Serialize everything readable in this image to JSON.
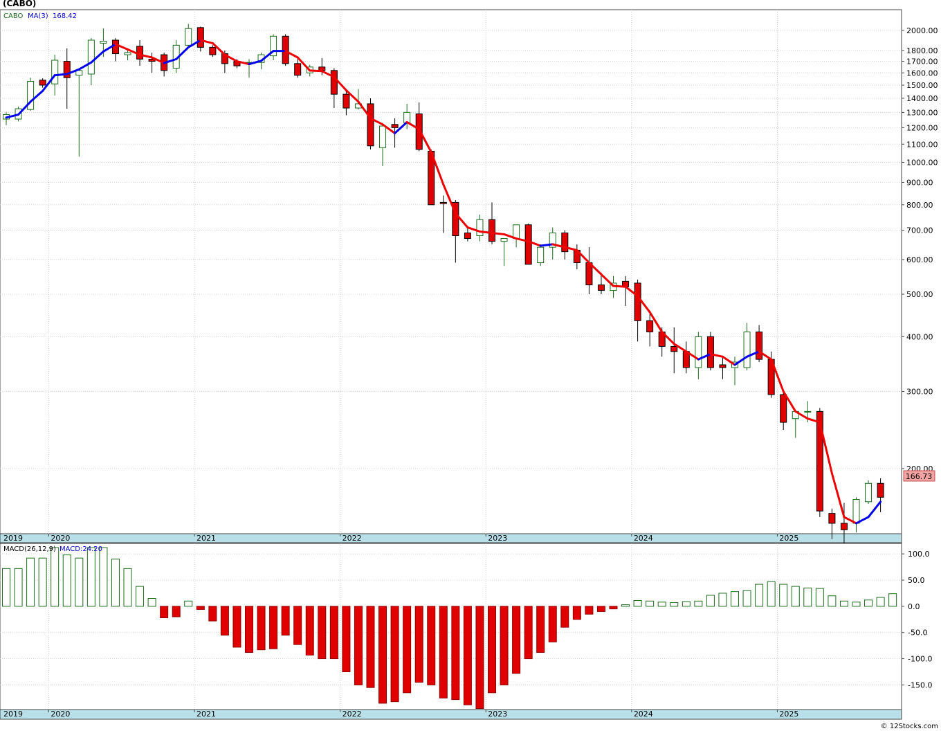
{
  "title": "(CABO)",
  "watermark": "© 12Stocks.com",
  "colors": {
    "up_candle_stroke": "#1a6b1a",
    "down_candle_fill": "#e00000",
    "ma_up": "#0000ee",
    "ma_down": "#ee0000",
    "axis_band": "#b9dfe8",
    "grid": "#d0d0d0",
    "last_price_label_bg": "#f4a3a3",
    "legend_symbol": "#1a6b1a",
    "legend_value": "#0000cc"
  },
  "chart_data": [
    {
      "type": "candlestick",
      "panel": "price",
      "legend": {
        "symbol": "CABO",
        "ma_label": "MA(3)",
        "ma_value": "168.42"
      },
      "last_price_label": "166.73",
      "y_scale": "log",
      "ylim": [
        142,
        2230
      ],
      "y_ticks": [
        200,
        300,
        400,
        500,
        600,
        700,
        800,
        900,
        1000,
        1100,
        1200,
        1300,
        1400,
        1500,
        1600,
        1700,
        1800,
        2000
      ],
      "y_tick_labels": [
        "200.00",
        "300.00",
        "400.00",
        "500.00",
        "600.00",
        "700.00",
        "800.00",
        "900.00",
        "1000.00",
        "1100.00",
        "1200.00",
        "1300.00",
        "1400.00",
        "1500.00",
        "1600.00",
        "1700.00",
        "1800.00",
        "2000.00"
      ],
      "x_labels": [
        "2019",
        "2020",
        "2021",
        "2022",
        "2023",
        "2024",
        "2025"
      ],
      "x_label_months": [
        0,
        4,
        16,
        28,
        40,
        52,
        64
      ],
      "months_total": 75,
      "candles": [
        {
          "o": 1255,
          "h": 1300,
          "l": 1215,
          "c": 1285
        },
        {
          "o": 1255,
          "h": 1340,
          "l": 1240,
          "c": 1325
        },
        {
          "o": 1320,
          "h": 1560,
          "l": 1310,
          "c": 1530
        },
        {
          "o": 1540,
          "h": 1555,
          "l": 1480,
          "c": 1500
        },
        {
          "o": 1510,
          "h": 1760,
          "l": 1420,
          "c": 1710
        },
        {
          "o": 1700,
          "h": 1820,
          "l": 1325,
          "c": 1560
        },
        {
          "o": 1580,
          "h": 1640,
          "l": 1030,
          "c": 1620
        },
        {
          "o": 1590,
          "h": 1920,
          "l": 1500,
          "c": 1900
        },
        {
          "o": 1870,
          "h": 2020,
          "l": 1740,
          "c": 1890
        },
        {
          "o": 1900,
          "h": 1920,
          "l": 1700,
          "c": 1770
        },
        {
          "o": 1760,
          "h": 1820,
          "l": 1710,
          "c": 1780
        },
        {
          "o": 1840,
          "h": 1900,
          "l": 1660,
          "c": 1720
        },
        {
          "o": 1720,
          "h": 1780,
          "l": 1600,
          "c": 1700
        },
        {
          "o": 1760,
          "h": 1780,
          "l": 1570,
          "c": 1620
        },
        {
          "o": 1640,
          "h": 1900,
          "l": 1600,
          "c": 1850
        },
        {
          "o": 1850,
          "h": 2070,
          "l": 1830,
          "c": 2020
        },
        {
          "o": 2030,
          "h": 2040,
          "l": 1790,
          "c": 1830
        },
        {
          "o": 1830,
          "h": 1850,
          "l": 1740,
          "c": 1760
        },
        {
          "o": 1770,
          "h": 1800,
          "l": 1600,
          "c": 1680
        },
        {
          "o": 1700,
          "h": 1720,
          "l": 1640,
          "c": 1660
        },
        {
          "o": 1690,
          "h": 1720,
          "l": 1560,
          "c": 1690
        },
        {
          "o": 1690,
          "h": 1780,
          "l": 1630,
          "c": 1760
        },
        {
          "o": 1750,
          "h": 1960,
          "l": 1710,
          "c": 1940
        },
        {
          "o": 1940,
          "h": 1960,
          "l": 1660,
          "c": 1680
        },
        {
          "o": 1680,
          "h": 1720,
          "l": 1560,
          "c": 1580
        },
        {
          "o": 1600,
          "h": 1670,
          "l": 1570,
          "c": 1650
        },
        {
          "o": 1650,
          "h": 1730,
          "l": 1580,
          "c": 1620
        },
        {
          "o": 1620,
          "h": 1640,
          "l": 1330,
          "c": 1430
        },
        {
          "o": 1430,
          "h": 1470,
          "l": 1280,
          "c": 1330
        },
        {
          "o": 1330,
          "h": 1470,
          "l": 1320,
          "c": 1360
        },
        {
          "o": 1360,
          "h": 1400,
          "l": 1070,
          "c": 1090
        },
        {
          "o": 1080,
          "h": 1230,
          "l": 980,
          "c": 1210
        },
        {
          "o": 1220,
          "h": 1260,
          "l": 1080,
          "c": 1200
        },
        {
          "o": 1230,
          "h": 1360,
          "l": 1190,
          "c": 1300
        },
        {
          "o": 1290,
          "h": 1370,
          "l": 1060,
          "c": 1070
        },
        {
          "o": 1060,
          "h": 1070,
          "l": 800,
          "c": 800
        },
        {
          "o": 810,
          "h": 840,
          "l": 690,
          "c": 805
        },
        {
          "o": 810,
          "h": 820,
          "l": 590,
          "c": 680
        },
        {
          "o": 690,
          "h": 710,
          "l": 660,
          "c": 670
        },
        {
          "o": 680,
          "h": 760,
          "l": 660,
          "c": 740
        },
        {
          "o": 740,
          "h": 810,
          "l": 650,
          "c": 660
        },
        {
          "o": 660,
          "h": 670,
          "l": 580,
          "c": 670
        },
        {
          "o": 670,
          "h": 720,
          "l": 640,
          "c": 720
        },
        {
          "o": 720,
          "h": 725,
          "l": 585,
          "c": 585
        },
        {
          "o": 590,
          "h": 650,
          "l": 580,
          "c": 640
        },
        {
          "o": 640,
          "h": 710,
          "l": 600,
          "c": 690
        },
        {
          "o": 690,
          "h": 700,
          "l": 600,
          "c": 625
        },
        {
          "o": 630,
          "h": 650,
          "l": 570,
          "c": 590
        },
        {
          "o": 590,
          "h": 640,
          "l": 500,
          "c": 525
        },
        {
          "o": 525,
          "h": 560,
          "l": 500,
          "c": 510
        },
        {
          "o": 510,
          "h": 550,
          "l": 490,
          "c": 530
        },
        {
          "o": 535,
          "h": 550,
          "l": 470,
          "c": 520
        },
        {
          "o": 530,
          "h": 540,
          "l": 390,
          "c": 435
        },
        {
          "o": 435,
          "h": 450,
          "l": 380,
          "c": 410
        },
        {
          "o": 410,
          "h": 420,
          "l": 360,
          "c": 380
        },
        {
          "o": 380,
          "h": 420,
          "l": 330,
          "c": 370
        },
        {
          "o": 370,
          "h": 390,
          "l": 330,
          "c": 340
        },
        {
          "o": 340,
          "h": 410,
          "l": 320,
          "c": 400
        },
        {
          "o": 400,
          "h": 410,
          "l": 335,
          "c": 340
        },
        {
          "o": 345,
          "h": 360,
          "l": 320,
          "c": 340
        },
        {
          "o": 340,
          "h": 360,
          "l": 310,
          "c": 350
        },
        {
          "o": 340,
          "h": 430,
          "l": 335,
          "c": 410
        },
        {
          "o": 410,
          "h": 425,
          "l": 350,
          "c": 355
        },
        {
          "o": 355,
          "h": 370,
          "l": 290,
          "c": 295
        },
        {
          "o": 295,
          "h": 300,
          "l": 245,
          "c": 255
        },
        {
          "o": 260,
          "h": 270,
          "l": 235,
          "c": 270
        },
        {
          "o": 270,
          "h": 285,
          "l": 255,
          "c": 270
        },
        {
          "o": 270,
          "h": 275,
          "l": 155,
          "c": 160
        },
        {
          "o": 158,
          "h": 162,
          "l": 138,
          "c": 150
        },
        {
          "o": 150,
          "h": 167,
          "l": 135,
          "c": 145
        },
        {
          "o": 150,
          "h": 172,
          "l": 143,
          "c": 170
        },
        {
          "o": 168,
          "h": 188,
          "l": 166,
          "c": 185
        },
        {
          "o": 185,
          "h": 190,
          "l": 159,
          "c": 172
        }
      ],
      "ma": [
        1265,
        1285,
        1375,
        1455,
        1580,
        1590,
        1630,
        1690,
        1790,
        1860,
        1810,
        1760,
        1735,
        1685,
        1720,
        1830,
        1900,
        1870,
        1760,
        1700,
        1675,
        1705,
        1795,
        1795,
        1735,
        1620,
        1615,
        1565,
        1460,
        1375,
        1260,
        1220,
        1165,
        1235,
        1190,
        1055,
        890,
        765,
        710,
        695,
        690,
        685,
        670,
        660,
        645,
        650,
        640,
        630,
        590,
        555,
        522,
        520,
        495,
        455,
        410,
        385,
        370,
        355,
        365,
        360,
        345,
        360,
        370,
        355,
        300,
        270,
        260,
        255,
        195,
        155,
        150,
        155,
        168
      ]
    },
    {
      "type": "bar",
      "panel": "macd",
      "legend": {
        "label": "MACD(26,12,9)",
        "value_label": "MACD:24.20"
      },
      "ylim": [
        -197,
        120
      ],
      "y_ticks": [
        100,
        50,
        0,
        -50,
        -100,
        -150
      ],
      "y_tick_labels": [
        "100.0",
        "50.0",
        "0.0",
        "-50.0",
        "-100.0",
        "-150.0"
      ],
      "x_labels": [
        "2019",
        "2020",
        "2021",
        "2022",
        "2023",
        "2024",
        "2025"
      ],
      "values": [
        72,
        72,
        92,
        92,
        112,
        98,
        92,
        112,
        112,
        90,
        72,
        38,
        15,
        -22,
        -20,
        10,
        -6,
        -28,
        -55,
        -78,
        -88,
        -83,
        -81,
        -55,
        -73,
        -93,
        -100,
        -100,
        -125,
        -150,
        -155,
        -185,
        -182,
        -165,
        -145,
        -150,
        -175,
        -178,
        -188,
        -195,
        -165,
        -150,
        -128,
        -100,
        -88,
        -68,
        -40,
        -25,
        -15,
        -10,
        -5,
        3,
        11,
        10,
        8,
        7,
        9,
        10,
        21,
        25,
        28,
        30,
        42,
        47,
        42,
        38,
        35,
        34,
        20,
        10,
        8,
        12,
        17,
        24
      ]
    }
  ]
}
